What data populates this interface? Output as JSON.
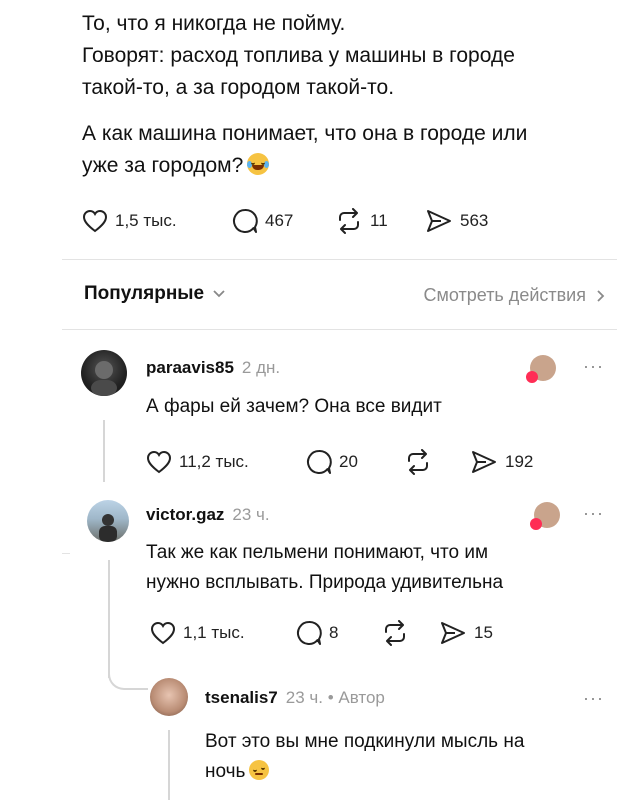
{
  "post": {
    "line1": "То, что я никогда не пойму.",
    "line2": "Говорят: расход топлива у машины в городе",
    "line3": "такой-то, а за городом такой-то.",
    "line4": "А как машина понимает, что она в городе или",
    "line5": "уже за городом?",
    "emoji": "laughing-tears-emoji",
    "likes": "1,5 тыс.",
    "comments": "467",
    "reposts": "11",
    "shares": "563"
  },
  "sort": {
    "label": "Популярные",
    "view_activity": "Смотреть действия"
  },
  "comments": [
    {
      "username": "paraavis85",
      "time": "2 дн.",
      "text": "А фары ей зачем? Она все видит",
      "likes": "11,2 тыс.",
      "replies": "20",
      "reposts": "",
      "shares": "192",
      "more": "···"
    },
    {
      "username": "victor.gaz",
      "time": "23 ч.",
      "text_line1": "Так же как пельмени понимают, что им",
      "text_line2": "нужно всплывать. Природа удивительна",
      "likes": "1,1 тыс.",
      "replies": "8",
      "reposts": "",
      "shares": "15",
      "more": "···"
    },
    {
      "username": "tsenalis7",
      "time": "23 ч. • Автор",
      "text_line1": "Вот это вы мне подкинули мысль на",
      "text_line2": "ночь",
      "emoji": "thinking-raised-eyebrow-emoji",
      "more": "···"
    }
  ],
  "colors": {
    "text": "#111111",
    "muted": "#9a9a9a",
    "divider": "#e3e3e3",
    "heart_badge": "#ff2d55"
  }
}
